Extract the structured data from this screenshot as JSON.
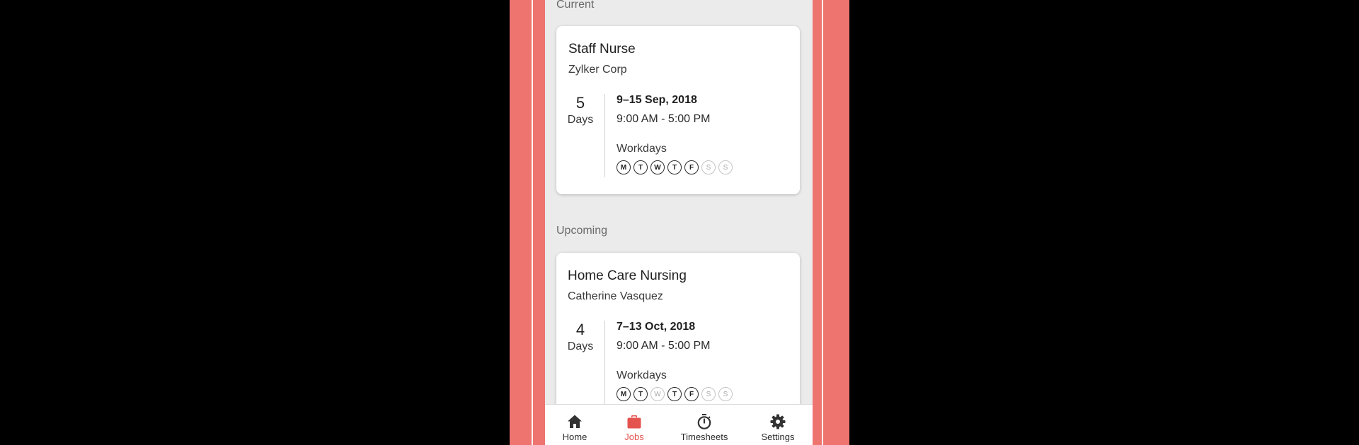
{
  "sections": {
    "current_label": "Current",
    "upcoming_label": "Upcoming"
  },
  "jobs": [
    {
      "title": "Staff Nurse",
      "client": "Zylker Corp",
      "days_count": "5",
      "days_unit": "Days",
      "dates": "9–15 Sep, 2018",
      "times": "9:00 AM - 5:00 PM",
      "workdays_label": "Workdays",
      "workdays": [
        {
          "letter": "M",
          "active": true
        },
        {
          "letter": "T",
          "active": true
        },
        {
          "letter": "W",
          "active": true
        },
        {
          "letter": "T",
          "active": true
        },
        {
          "letter": "F",
          "active": true
        },
        {
          "letter": "S",
          "active": false
        },
        {
          "letter": "S",
          "active": false
        }
      ]
    },
    {
      "title": "Home Care Nursing",
      "client": "Catherine Vasquez",
      "days_count": "4",
      "days_unit": "Days",
      "dates": "7–13 Oct, 2018",
      "times": "9:00 AM - 5:00 PM",
      "workdays_label": "Workdays",
      "workdays": [
        {
          "letter": "M",
          "active": true
        },
        {
          "letter": "T",
          "active": true
        },
        {
          "letter": "W",
          "active": false
        },
        {
          "letter": "T",
          "active": true
        },
        {
          "letter": "F",
          "active": true
        },
        {
          "letter": "S",
          "active": false
        },
        {
          "letter": "S",
          "active": false
        }
      ]
    }
  ],
  "tabbar": {
    "tabs": [
      {
        "label": "Home",
        "icon": "home-icon",
        "active": false
      },
      {
        "label": "Jobs",
        "icon": "briefcase-icon",
        "active": true
      },
      {
        "label": "Timesheets",
        "icon": "stopwatch-icon",
        "active": false
      },
      {
        "label": "Settings",
        "icon": "gear-icon",
        "active": false
      }
    ]
  },
  "colors": {
    "accent": "#e5534f",
    "frame": "#ee7470",
    "content_bg": "#ebebeb"
  }
}
